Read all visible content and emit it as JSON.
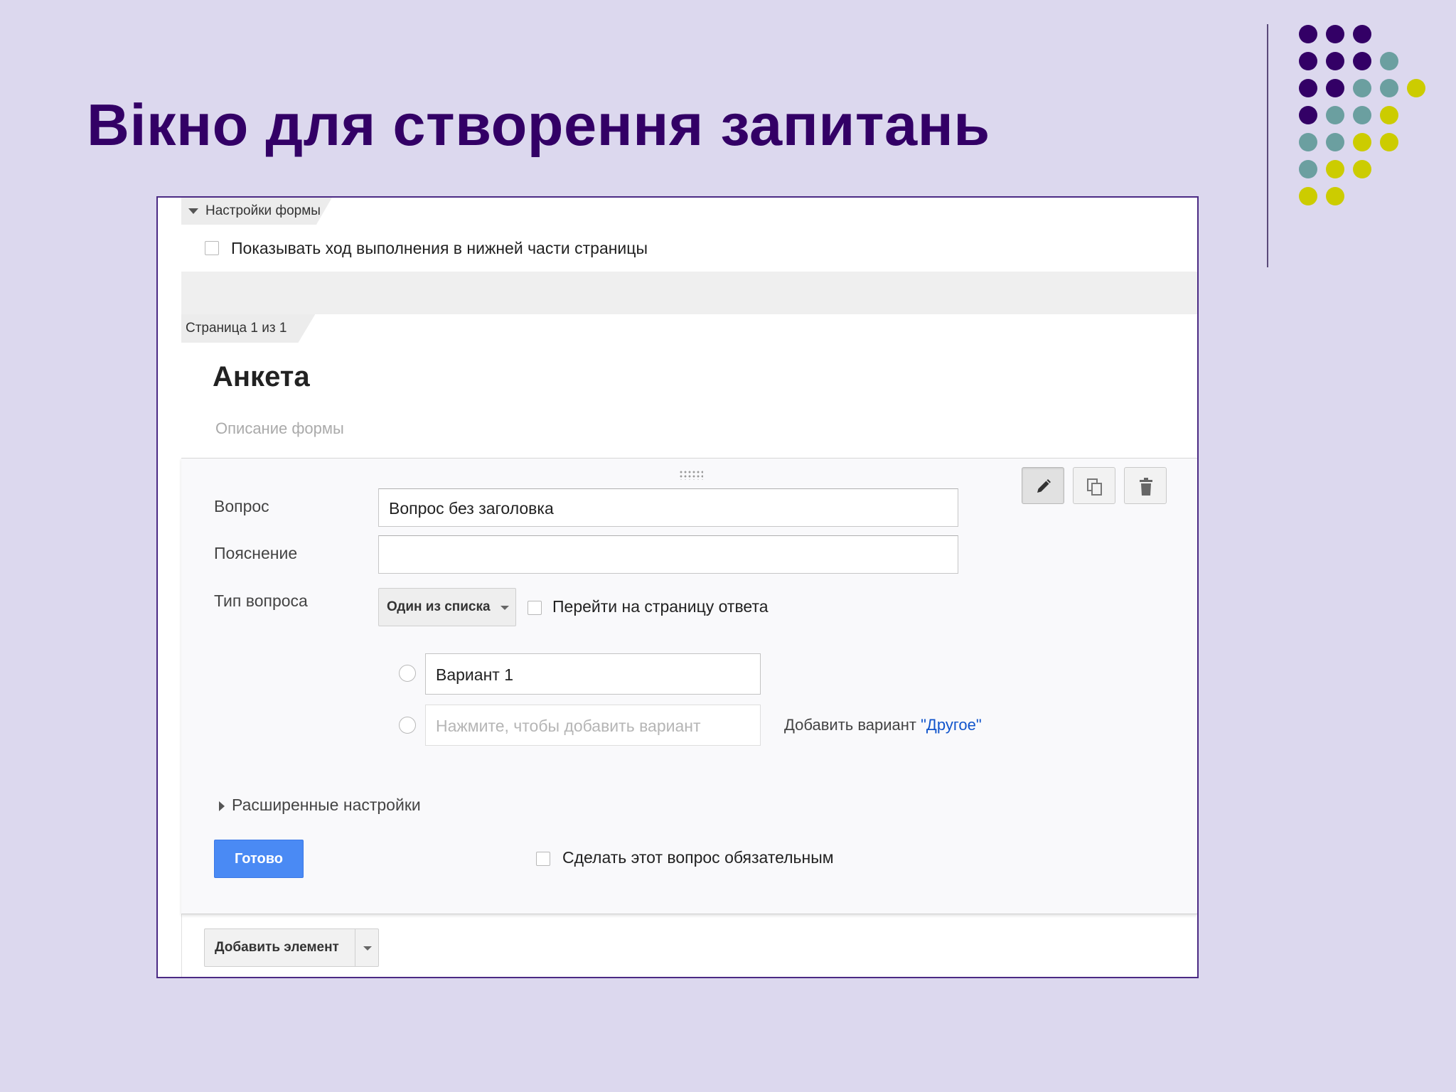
{
  "slide": {
    "title": "Вікно для створення запитань",
    "colors": {
      "title": "#330066",
      "background": "#dcd8ee",
      "dot_purple": "#330066",
      "dot_teal": "#6b9fa0",
      "dot_yellow": "#cccc00"
    }
  },
  "form_settings": {
    "section_label": "Настройки формы",
    "progress_checkbox_label": "Показывать ход выполнения в нижней части страницы"
  },
  "page": {
    "page_indicator": "Страница 1 из 1",
    "form_title": "Анкета",
    "form_description_placeholder": "Описание формы"
  },
  "question_editor": {
    "toolbar": {
      "edit_icon": "pencil-icon",
      "copy_icon": "duplicate-icon",
      "delete_icon": "trash-icon"
    },
    "question_label": "Вопрос",
    "question_value": "Вопрос без заголовка",
    "help_label": "Пояснение",
    "help_value": "",
    "type_label": "Тип вопроса",
    "type_selected": "Один из списка",
    "go_to_page_label": "Перейти на страницу ответа",
    "options": [
      {
        "value": "Вариант 1"
      }
    ],
    "add_option_placeholder": "Нажмите, чтобы добавить вариант",
    "add_other_prefix": "Добавить вариант ",
    "add_other_link": "\"Другое\"",
    "advanced_settings_label": "Расширенные настройки",
    "done_button": "Готово",
    "required_label": "Сделать этот вопрос обязательным"
  },
  "add_item_button": "Добавить элемент"
}
